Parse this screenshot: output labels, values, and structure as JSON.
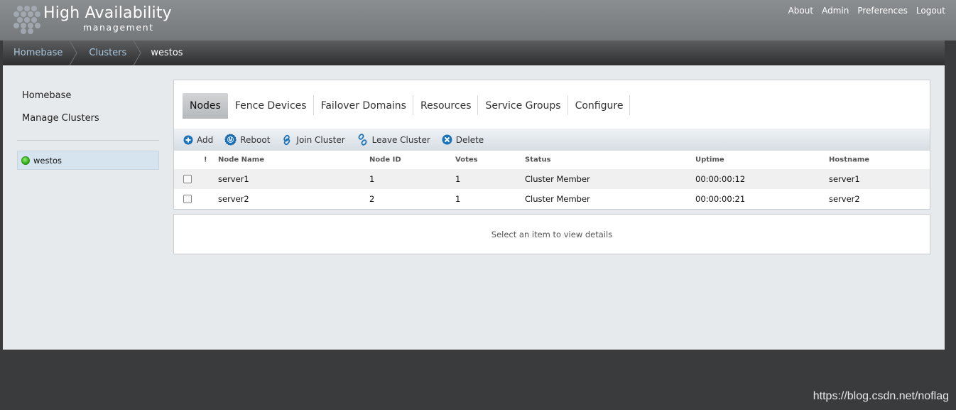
{
  "header": {
    "title": "High Availability",
    "subtitle": "management",
    "links": [
      "About",
      "Admin",
      "Preferences",
      "Logout"
    ]
  },
  "breadcrumb": [
    "Homebase",
    "Clusters",
    "westos"
  ],
  "sidebar": {
    "items": [
      "Homebase",
      "Manage Clusters"
    ],
    "cluster": {
      "name": "westos",
      "status_color": "#3cc31f"
    }
  },
  "tabs": [
    "Nodes",
    "Fence Devices",
    "Failover Domains",
    "Resources",
    "Service Groups",
    "Configure"
  ],
  "active_tab": "Nodes",
  "toolbar": {
    "add": "Add",
    "reboot": "Reboot",
    "join": "Join Cluster",
    "leave": "Leave Cluster",
    "delete": "Delete"
  },
  "table": {
    "columns": [
      "!",
      "Node Name",
      "Node ID",
      "Votes",
      "Status",
      "Uptime",
      "Hostname"
    ],
    "rows": [
      [
        "server1",
        "1",
        "1",
        "Cluster Member",
        "00:00:00:12",
        "server1"
      ],
      [
        "server2",
        "2",
        "1",
        "Cluster Member",
        "00:00:00:21",
        "server2"
      ]
    ]
  },
  "details_text": "Select an item to view details",
  "watermark": "https://blog.csdn.net/noflag",
  "colors": {
    "accent": "#1a73b8",
    "link": "#a9c6dc"
  }
}
